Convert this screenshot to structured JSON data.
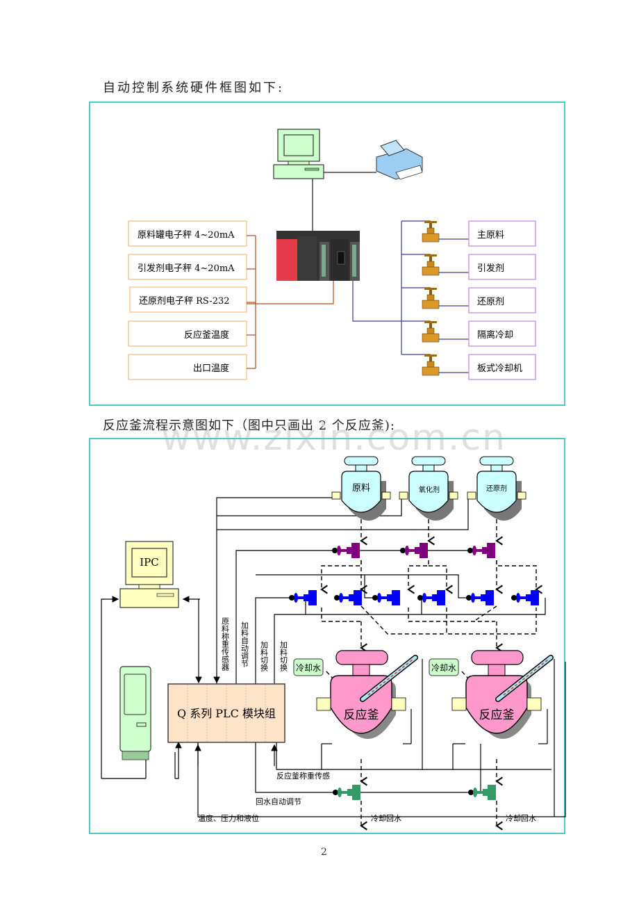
{
  "section1": {
    "heading": "自动控制系统硬件框图如下:",
    "inputs": [
      {
        "label": "原料罐电子秤 4~20mA"
      },
      {
        "label": "引发剂电子秤 4~20mA"
      },
      {
        "label": "还原剂电子秤 RS-232"
      },
      {
        "label": "反应釜温度"
      },
      {
        "label": "出口温度"
      }
    ],
    "outputs": [
      {
        "label": "主原料"
      },
      {
        "label": "引发剂"
      },
      {
        "label": "还原剂"
      },
      {
        "label": "隔离冷却"
      },
      {
        "label": "板式冷却机"
      }
    ],
    "devices": [
      "computer-icon",
      "printer-icon",
      "plc-rack-icon",
      "valve-icon"
    ],
    "colors": {
      "frame": "#4cc8c8",
      "input_box": "#f5c89a",
      "output_box": "#c89ae8",
      "input_line": "#b04a1a",
      "output_line": "#3a3aa0"
    }
  },
  "section2": {
    "heading": "反应釜流程示意图如下（图中只画出 2 个反应釜):",
    "ipc_label": "IPC",
    "plc_label": "Q 系列 PLC 模块组",
    "tanks": [
      {
        "label": "原料"
      },
      {
        "label": "氧化剂"
      },
      {
        "label": "还原剂"
      }
    ],
    "reactors": [
      {
        "label": "反应釜"
      },
      {
        "label": "反应釜"
      }
    ],
    "cooling_water_tag": "冷却水",
    "vertical_labels": [
      "原料称重传感器",
      "加料自动调节",
      "加料切换",
      "加料切换"
    ],
    "reactor_weight_label": "反应釜称重传感",
    "return_water_label": "回水自动调节",
    "temp_label": "温度、压力和液位",
    "cooling_return": [
      "冷却回水",
      "冷却回水"
    ],
    "colors": {
      "tank": "#ccffff",
      "reactor": "#ff99cc",
      "plc": "#fde3c8",
      "ipc": "#ffffc0",
      "terminal": "#ccffcc",
      "valve_purple": "#800080",
      "valve_blue": "#0000ff",
      "valve_green": "#339966"
    }
  },
  "watermark": "www.zixin.com.cn",
  "page_number": "2"
}
